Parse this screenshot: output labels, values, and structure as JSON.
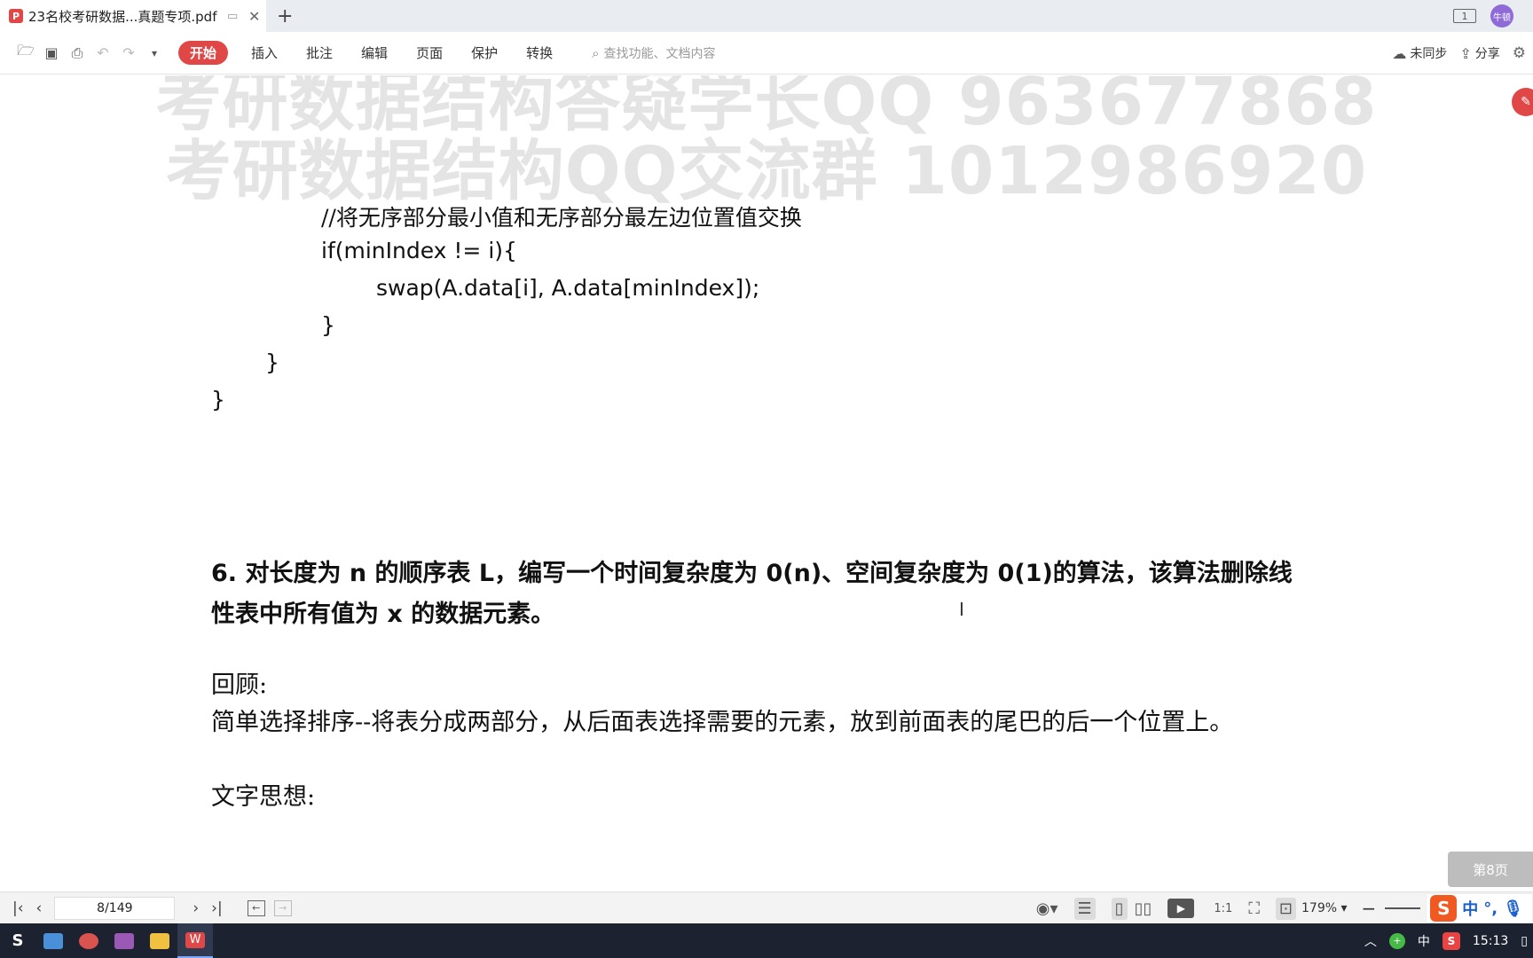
{
  "window": {
    "tab_title": "23名校考研数据...真题专项.pdf",
    "new_tab_icon": "plus-icon",
    "avatar_text": "牛顿"
  },
  "toolbar": {
    "menus": [
      "开始",
      "插入",
      "批注",
      "编辑",
      "页面",
      "保护",
      "转换"
    ],
    "search_placeholder": "查找功能、文档内容",
    "sync_label": "未同步",
    "share_label": "分享"
  },
  "document": {
    "watermark_line1": "考研数据结构答疑学长QQ 963677868",
    "watermark_line2": "考研数据结构QQ交流群 1012986920",
    "code_lines": [
      "//将无序部分最小值和无序部分最左边位置值交换",
      "if(minIndex != i){",
      "swap(A.data[i], A.data[minIndex]);",
      "}",
      "}",
      "}"
    ],
    "question": "6.  对长度为 n 的顺序表 L，编写一个时间复杂度为 0(n)、空间复杂度为 0(1)的算法，该算法删除线性表中所有值为 x 的数据元素。",
    "review_label": "回顾:",
    "review_text": "简单选择排序--将表分成两部分，从后面表选择需要的元素，放到前面表的尾巴的后一个位置上。",
    "thought_label": "文字思想:",
    "page_badge": "第8页"
  },
  "statusbar": {
    "page_indicator": "8/149",
    "zoom": "179%"
  },
  "ime": {
    "mode": "中",
    "punct": "°,"
  },
  "taskbar": {
    "tray_ime": "中",
    "time": "15:13"
  }
}
